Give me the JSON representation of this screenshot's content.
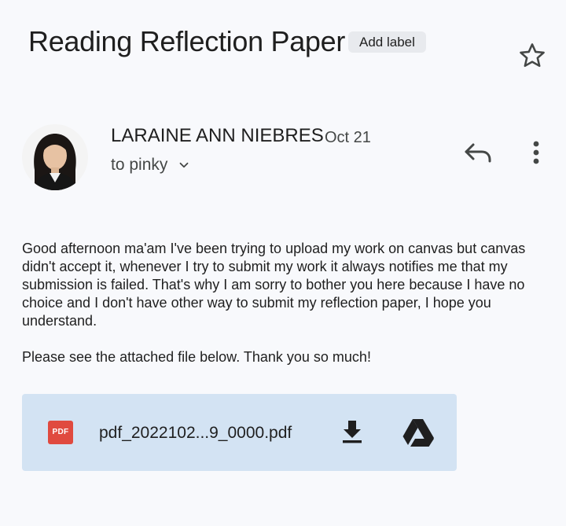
{
  "email": {
    "subject": "Reading Reflection Paper",
    "add_label": "Add label",
    "star_icon": "star-outline-icon",
    "sender_name": "LARAINE ANN NIEBRES",
    "date": "Oct 21",
    "recipient_text": "to pinky",
    "recipient_chevron_icon": "chevron-down-icon",
    "reply_icon": "reply-icon",
    "more_icon": "more-vert-icon",
    "body_paragraphs": [
      "Good afternoon ma'am I've been trying to upload my work on canvas but canvas didn't accept it, whenever I try to submit my work it always notifies me that my submission is failed. That's why I am sorry to bother you here because I have no choice and I don't have other way to submit my reflection paper, I hope you understand.",
      "Please see the attached file below. Thank you so much!"
    ]
  },
  "attachment": {
    "type_badge": "PDF",
    "filename": "pdf_2022102...9_0000.pdf",
    "download_icon": "download-icon",
    "drive_icon": "google-drive-icon"
  },
  "colors": {
    "background": "#f8f9fc",
    "attachment_bg": "#d3e3f3",
    "pdf_red": "#e04a3f",
    "label_chip_bg": "#e8eaee"
  }
}
